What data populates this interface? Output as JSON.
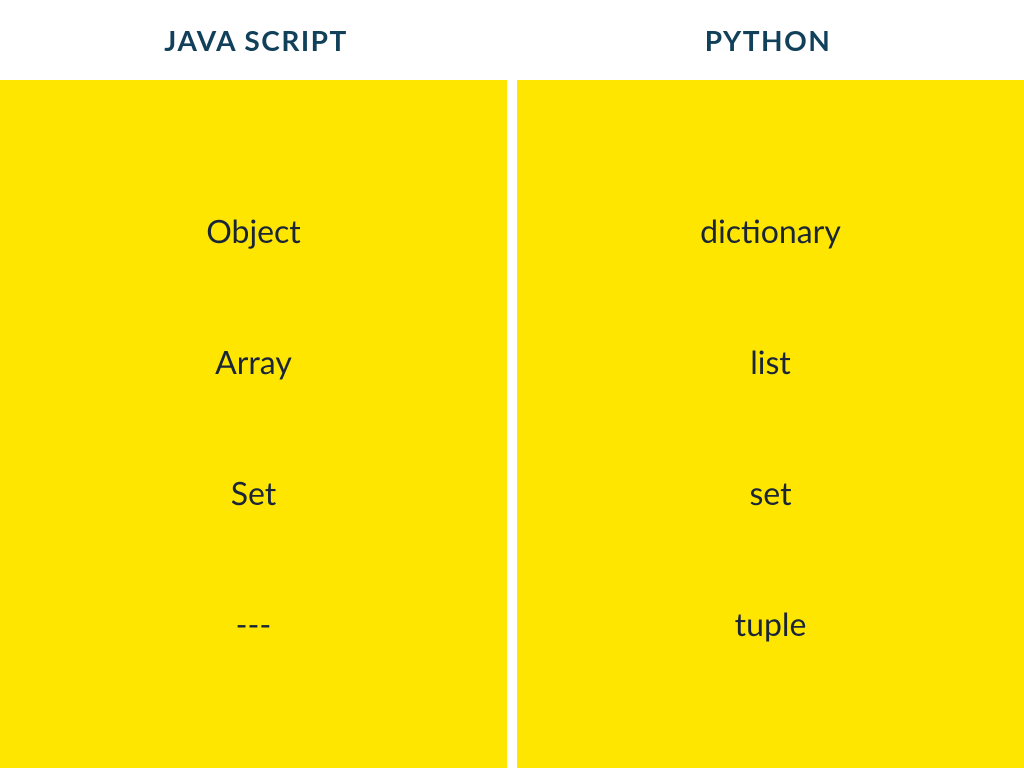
{
  "headers": {
    "left": "JAVA SCRIPT",
    "right": "PYTHON"
  },
  "columns": {
    "left": [
      "Object",
      "Array",
      "Set",
      "---"
    ],
    "right": [
      "dictionary",
      "list",
      "set",
      "tuple"
    ]
  },
  "chart_data": {
    "type": "table",
    "title": "",
    "columns": [
      "JAVA SCRIPT",
      "PYTHON"
    ],
    "rows": [
      [
        "Object",
        "dictionary"
      ],
      [
        "Array",
        "list"
      ],
      [
        "Set",
        "set"
      ],
      [
        "---",
        "tuple"
      ]
    ]
  }
}
